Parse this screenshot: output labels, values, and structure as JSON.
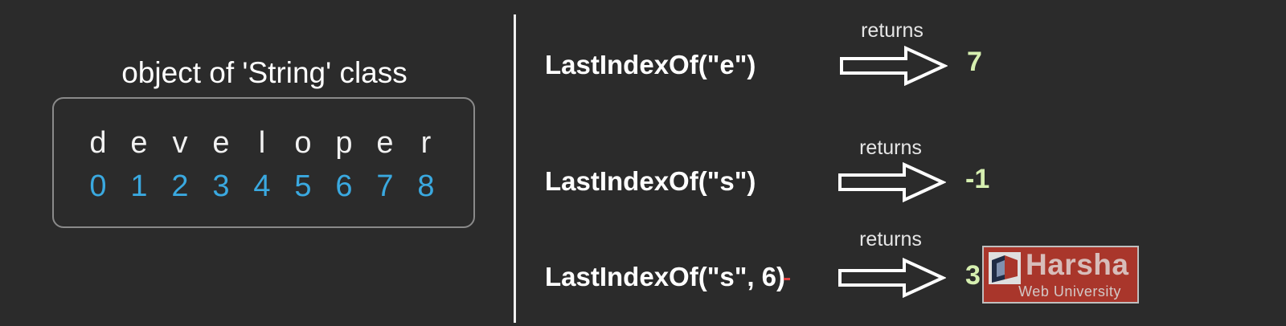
{
  "left_panel": {
    "caption": "object of 'String' class",
    "letters": [
      "d",
      "e",
      "v",
      "e",
      "l",
      "o",
      "p",
      "e",
      "r"
    ],
    "indices": [
      "0",
      "1",
      "2",
      "3",
      "4",
      "5",
      "6",
      "7",
      "8"
    ]
  },
  "examples": [
    {
      "call": "LastIndexOf(\"e\")",
      "returns_label": "returns",
      "result": "7"
    },
    {
      "call": "LastIndexOf(\"s\")",
      "returns_label": "returns",
      "result": "-1"
    },
    {
      "call": "LastIndexOf(\"s\", 6)",
      "returns_label": "returns",
      "result": "3"
    }
  ],
  "watermark": {
    "name": "Harsha",
    "subtitle": "Web University"
  },
  "colors": {
    "background": "#2b2b2b",
    "index_blue": "#3aa9e0",
    "result_green": "#d6efb0",
    "logo_red": "#c0392b"
  }
}
